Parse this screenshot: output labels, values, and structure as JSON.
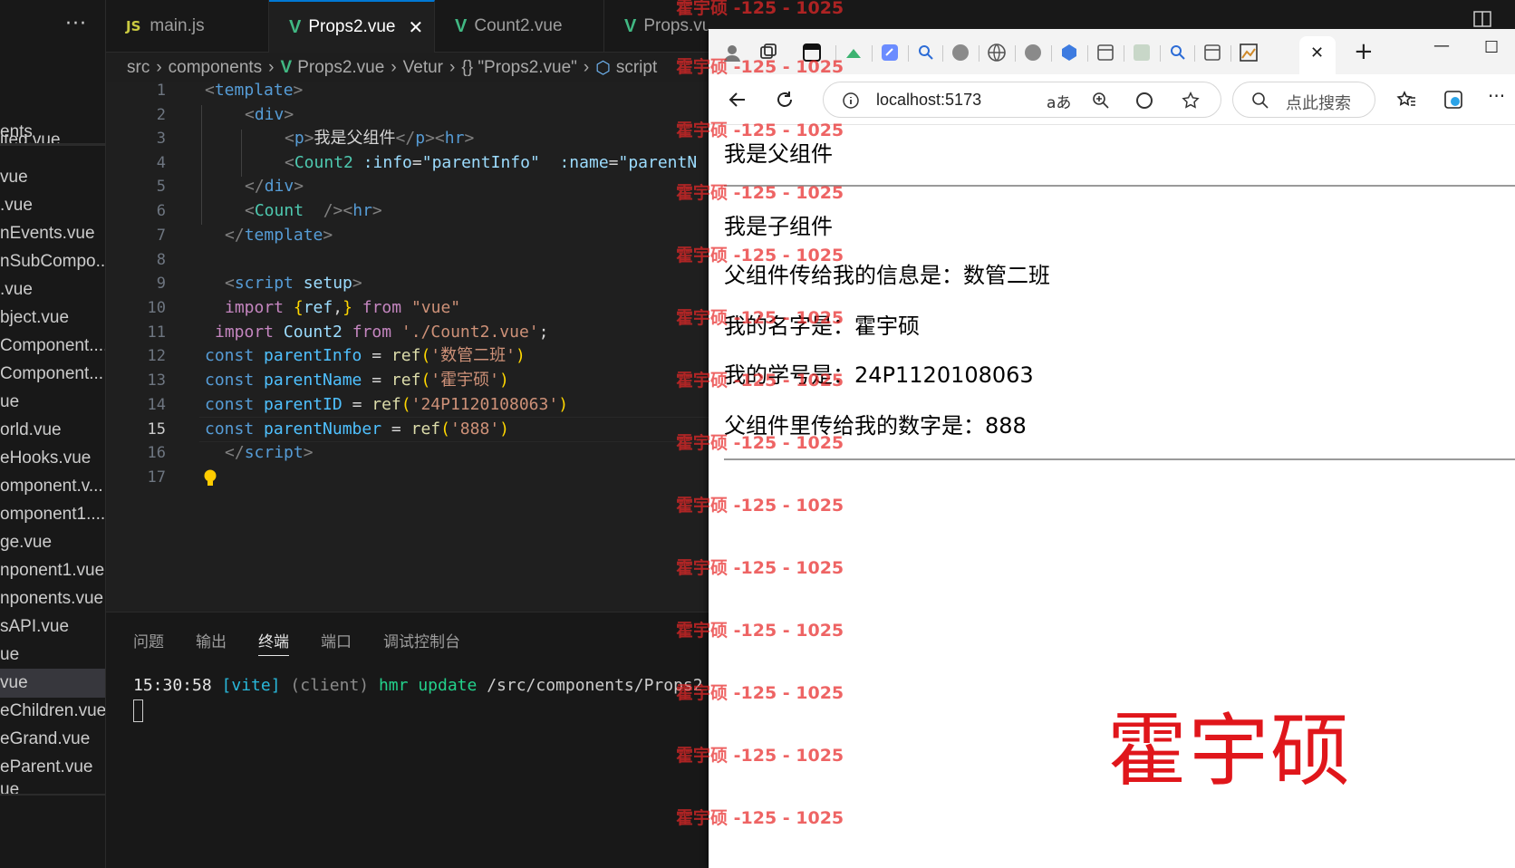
{
  "explorer": {
    "items": [
      "ents",
      "ited.vue",
      "vue",
      ".vue",
      "nEvents.vue",
      "nSubCompo...",
      ".vue",
      "bject.vue",
      "Component....",
      "Component...",
      "ue",
      "orld.vue",
      "eHooks.vue",
      "omponent.v...",
      "omponent1....",
      "ge.vue",
      "nponent1.vue",
      "nponents.vue",
      "sAPI.vue",
      "ue",
      "vue",
      "eChildren.vue",
      "eGrand.vue",
      "eParent.vue",
      "ue"
    ]
  },
  "tabs": [
    {
      "label": "main.js",
      "icon": "js-icon"
    },
    {
      "label": "Props2.vue",
      "icon": "vue-icon",
      "active": true
    },
    {
      "label": "Count2.vue",
      "icon": "vue-icon"
    },
    {
      "label": "Props.vue",
      "icon": "vue-icon"
    }
  ],
  "breadcrumb": {
    "src": "src",
    "components": "components",
    "file": "Props2.vue",
    "vetur": "Vetur",
    "obj": "{} \"Props2.vue\"",
    "script": "script"
  },
  "editor": {
    "line_numbers": [
      "1",
      "2",
      "3",
      "4",
      "5",
      "6",
      "7",
      "8",
      "9",
      "10",
      "11",
      "12",
      "13",
      "14",
      "15",
      "16",
      "17"
    ],
    "current_line": "15",
    "code": {
      "l1_open": "<",
      "l1_tag": "template",
      "l1_close": ">",
      "l2_open": "<",
      "l2_tag": "div",
      "l2_close": ">",
      "l3_a": "<",
      "l3_p": "p",
      "l3_b": ">",
      "l3_text": "我是父组件",
      "l3_c": "</",
      "l3_p2": "p",
      "l3_d": "><",
      "l3_hr": "hr",
      "l3_e": ">",
      "l4_a": "<",
      "l4_tag": "Count2",
      "l4_attr1": " :info",
      "l4_eq1": "=",
      "l4_val1": "\"parentInfo\"",
      "l4_attr2": "  :name",
      "l4_eq2": "=",
      "l4_val2": "\"parentN",
      "l5_a": "</",
      "l5_tag": "div",
      "l5_b": ">",
      "l6_a": "<",
      "l6_tag": "Count",
      "l6_b": "  />",
      "l6_c": "<",
      "l6_hr": "hr",
      "l6_d": ">",
      "l7_a": "</",
      "l7_tag": "template",
      "l7_b": ">",
      "l9_a": "<",
      "l9_tag": "script",
      "l9_attr": " setup",
      "l9_b": ">",
      "l10_kw": "import",
      "l10_b1": " {",
      "l10_ref": "ref",
      "l10_comma": ",",
      "l10_b2": "}",
      "l10_from": " from",
      "l10_str": " \"vue\"",
      "l11_kw": "import",
      "l11_name": " Count2",
      "l11_from": " from",
      "l11_str": " './Count2.vue'",
      "l11_semi": ";",
      "l12_const": "const",
      "l12_var": " parentInfo",
      "l12_eq": " =",
      "l12_fn": " ref",
      "l12_p1": "(",
      "l12_str": "'数管二班'",
      "l12_p2": ")",
      "l13_const": "const",
      "l13_var": " parentName",
      "l13_eq": " =",
      "l13_fn": " ref",
      "l13_p1": "(",
      "l13_str": "'霍宇硕'",
      "l13_p2": ")",
      "l14_const": "const",
      "l14_var": " parentID",
      "l14_eq": " =",
      "l14_fn": " ref",
      "l14_p1": "(",
      "l14_str": "'24P1120108063'",
      "l14_p2": ")",
      "l15_const": "const",
      "l15_var": " parentNumber",
      "l15_eq": " =",
      "l15_fn": " ref",
      "l15_p1": "(",
      "l15_str": "'888'",
      "l15_p2": ")",
      "l16_a": "</",
      "l16_tag": "script",
      "l16_b": ">"
    }
  },
  "panel": {
    "tabs": [
      "问题",
      "输出",
      "终端",
      "端口",
      "调试控制台"
    ],
    "active_tab": "终端",
    "terminal": {
      "time": "15:30:58",
      "vite": "[vite]",
      "client": "(client)",
      "hmr": "hmr update",
      "path": "/src/components/Props2"
    }
  },
  "browser": {
    "url": "localhost:5173",
    "search_placeholder": "点此搜索",
    "page": {
      "parent_title": "我是父组件",
      "child_title": "我是子组件",
      "info_line": "父组件传给我的信息是：数管二班",
      "name_line": "我的名字是：霍宇硕",
      "id_line": "我的学号是：24P1120108063",
      "number_line": "父组件里传给我的数字是：888"
    },
    "signature": "霍宇硕"
  },
  "watermark": "霍宇硕 -125 - 1025",
  "colors": {
    "vue_green": "#41b883",
    "accent_blue": "#0078d4",
    "watermark_red": "#e82828",
    "signature_red": "#e0161b"
  }
}
